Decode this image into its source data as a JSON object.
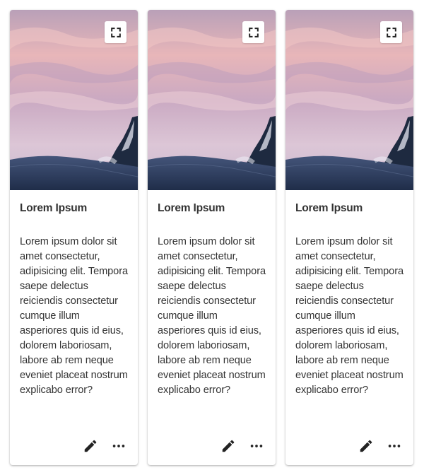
{
  "cards": [
    {
      "title": "Lorem Ipsum",
      "body": "Lorem ipsum dolor sit amet consectetur, adipisicing elit. Tempora saepe delectus reiciendis consectetur cumque illum asperiores quis id eius, dolorem laboriosam, labore ab rem neque eveniet placeat nostrum explicabo error?",
      "image_icon": "fullscreen-icon",
      "actions": [
        "edit-icon",
        "more-horizontal-icon"
      ]
    },
    {
      "title": "Lorem Ipsum",
      "body": "Lorem ipsum dolor sit amet consectetur, adipisicing elit. Tempora saepe delectus reiciendis consectetur cumque illum asperiores quis id eius, dolorem laboriosam, labore ab rem neque eveniet placeat nostrum explicabo error?",
      "image_icon": "fullscreen-icon",
      "actions": [
        "edit-icon",
        "more-horizontal-icon"
      ]
    },
    {
      "title": "Lorem Ipsum",
      "body": "Lorem ipsum dolor sit amet consectetur, adipisicing elit. Tempora saepe delectus reiciendis consectetur cumque illum asperiores quis id eius, dolorem laboriosam, labore ab rem neque eveniet placeat nostrum explicabo error?",
      "image_icon": "fullscreen-icon",
      "actions": [
        "edit-icon",
        "more-horizontal-icon"
      ]
    }
  ],
  "colors": {
    "sky_top": "#c9a7b8",
    "sky_mid": "#e9b7b9",
    "sky_low": "#d9c1d4",
    "snow_dark": "#2c3d5c",
    "icon": "#222222"
  }
}
